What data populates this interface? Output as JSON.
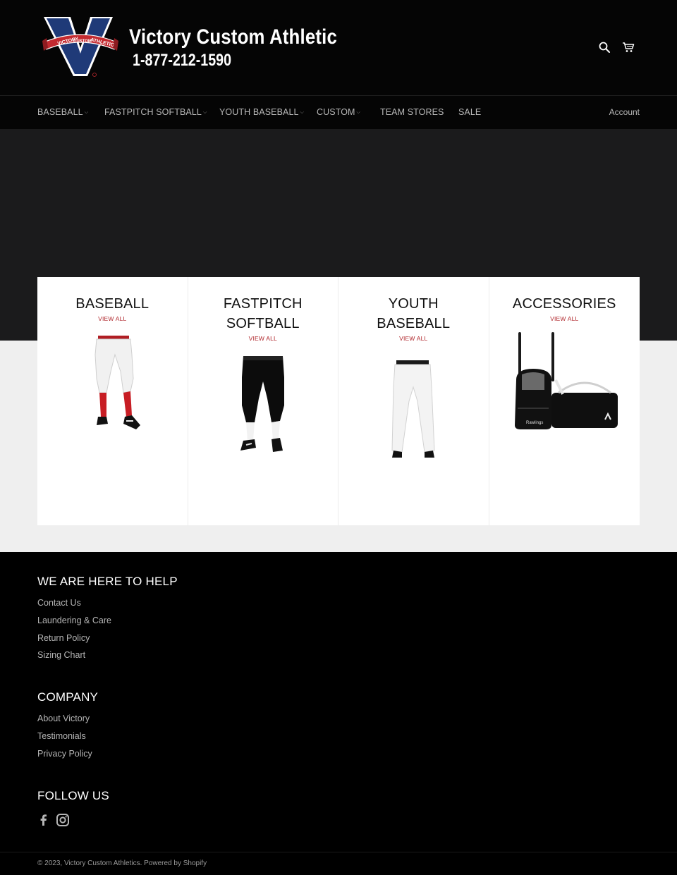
{
  "header": {
    "brand_title": "Victory Custom Athletic",
    "phone": "1-877-212-1590",
    "logo_text_victory": "VICTORY",
    "logo_text_custom": "CUSTOM",
    "logo_text_athletic": "ATHLETIC",
    "search_icon": "search-icon",
    "cart_icon": "cart-icon"
  },
  "nav": {
    "items": [
      {
        "label": "BASEBALL",
        "has_dropdown": true
      },
      {
        "label": "FASTPITCH SOFTBALL",
        "has_dropdown": true
      },
      {
        "label": "YOUTH BASEBALL",
        "has_dropdown": true
      },
      {
        "label": "CUSTOM",
        "has_dropdown": true
      },
      {
        "label": "TEAM STORES",
        "has_dropdown": false
      },
      {
        "label": "SALE",
        "has_dropdown": false
      }
    ],
    "caret": "⌵",
    "account": "Account"
  },
  "collections": [
    {
      "title": "BASEBALL",
      "link": "VIEW ALL"
    },
    {
      "title": "FASTPITCH SOFTBALL",
      "link": "VIEW ALL"
    },
    {
      "title": "YOUTH BASEBALL",
      "link": "VIEW ALL"
    },
    {
      "title": "ACCESSORIES",
      "link": "VIEW ALL"
    }
  ],
  "footer": {
    "help_heading": "WE ARE HERE TO HELP",
    "help_links": [
      "Contact Us",
      "Laundering & Care",
      "Return Policy",
      "Sizing Chart"
    ],
    "company_heading": "COMPANY",
    "company_links": [
      "About Victory",
      "Testimonials",
      "Privacy Policy"
    ],
    "follow_heading": "FOLLOW US",
    "social_icons": [
      "facebook-icon",
      "instagram-icon"
    ],
    "copyright": "© 2023, Victory Custom Athletics. Powered by Shopify"
  },
  "colors": {
    "background": "#000000",
    "hero": "#1b1b1c",
    "main": "#efefef",
    "accent_red": "#b0272c",
    "logo_navy": "#1f3a78"
  }
}
